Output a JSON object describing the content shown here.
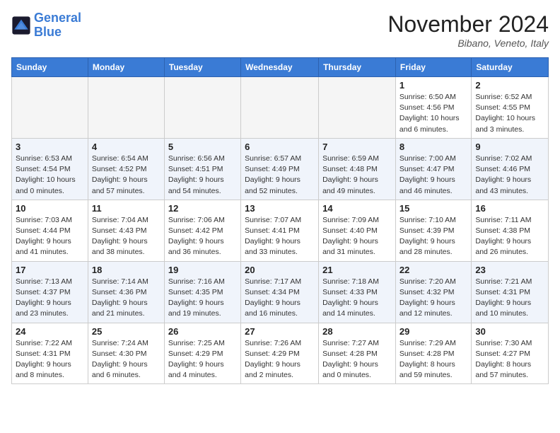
{
  "header": {
    "logo_line1": "General",
    "logo_line2": "Blue",
    "month_title": "November 2024",
    "location": "Bibano, Veneto, Italy"
  },
  "days_of_week": [
    "Sunday",
    "Monday",
    "Tuesday",
    "Wednesday",
    "Thursday",
    "Friday",
    "Saturday"
  ],
  "weeks": [
    [
      {
        "day": "",
        "info": ""
      },
      {
        "day": "",
        "info": ""
      },
      {
        "day": "",
        "info": ""
      },
      {
        "day": "",
        "info": ""
      },
      {
        "day": "",
        "info": ""
      },
      {
        "day": "1",
        "info": "Sunrise: 6:50 AM\nSunset: 4:56 PM\nDaylight: 10 hours\nand 6 minutes."
      },
      {
        "day": "2",
        "info": "Sunrise: 6:52 AM\nSunset: 4:55 PM\nDaylight: 10 hours\nand 3 minutes."
      }
    ],
    [
      {
        "day": "3",
        "info": "Sunrise: 6:53 AM\nSunset: 4:54 PM\nDaylight: 10 hours\nand 0 minutes."
      },
      {
        "day": "4",
        "info": "Sunrise: 6:54 AM\nSunset: 4:52 PM\nDaylight: 9 hours\nand 57 minutes."
      },
      {
        "day": "5",
        "info": "Sunrise: 6:56 AM\nSunset: 4:51 PM\nDaylight: 9 hours\nand 54 minutes."
      },
      {
        "day": "6",
        "info": "Sunrise: 6:57 AM\nSunset: 4:49 PM\nDaylight: 9 hours\nand 52 minutes."
      },
      {
        "day": "7",
        "info": "Sunrise: 6:59 AM\nSunset: 4:48 PM\nDaylight: 9 hours\nand 49 minutes."
      },
      {
        "day": "8",
        "info": "Sunrise: 7:00 AM\nSunset: 4:47 PM\nDaylight: 9 hours\nand 46 minutes."
      },
      {
        "day": "9",
        "info": "Sunrise: 7:02 AM\nSunset: 4:46 PM\nDaylight: 9 hours\nand 43 minutes."
      }
    ],
    [
      {
        "day": "10",
        "info": "Sunrise: 7:03 AM\nSunset: 4:44 PM\nDaylight: 9 hours\nand 41 minutes."
      },
      {
        "day": "11",
        "info": "Sunrise: 7:04 AM\nSunset: 4:43 PM\nDaylight: 9 hours\nand 38 minutes."
      },
      {
        "day": "12",
        "info": "Sunrise: 7:06 AM\nSunset: 4:42 PM\nDaylight: 9 hours\nand 36 minutes."
      },
      {
        "day": "13",
        "info": "Sunrise: 7:07 AM\nSunset: 4:41 PM\nDaylight: 9 hours\nand 33 minutes."
      },
      {
        "day": "14",
        "info": "Sunrise: 7:09 AM\nSunset: 4:40 PM\nDaylight: 9 hours\nand 31 minutes."
      },
      {
        "day": "15",
        "info": "Sunrise: 7:10 AM\nSunset: 4:39 PM\nDaylight: 9 hours\nand 28 minutes."
      },
      {
        "day": "16",
        "info": "Sunrise: 7:11 AM\nSunset: 4:38 PM\nDaylight: 9 hours\nand 26 minutes."
      }
    ],
    [
      {
        "day": "17",
        "info": "Sunrise: 7:13 AM\nSunset: 4:37 PM\nDaylight: 9 hours\nand 23 minutes."
      },
      {
        "day": "18",
        "info": "Sunrise: 7:14 AM\nSunset: 4:36 PM\nDaylight: 9 hours\nand 21 minutes."
      },
      {
        "day": "19",
        "info": "Sunrise: 7:16 AM\nSunset: 4:35 PM\nDaylight: 9 hours\nand 19 minutes."
      },
      {
        "day": "20",
        "info": "Sunrise: 7:17 AM\nSunset: 4:34 PM\nDaylight: 9 hours\nand 16 minutes."
      },
      {
        "day": "21",
        "info": "Sunrise: 7:18 AM\nSunset: 4:33 PM\nDaylight: 9 hours\nand 14 minutes."
      },
      {
        "day": "22",
        "info": "Sunrise: 7:20 AM\nSunset: 4:32 PM\nDaylight: 9 hours\nand 12 minutes."
      },
      {
        "day": "23",
        "info": "Sunrise: 7:21 AM\nSunset: 4:31 PM\nDaylight: 9 hours\nand 10 minutes."
      }
    ],
    [
      {
        "day": "24",
        "info": "Sunrise: 7:22 AM\nSunset: 4:31 PM\nDaylight: 9 hours\nand 8 minutes."
      },
      {
        "day": "25",
        "info": "Sunrise: 7:24 AM\nSunset: 4:30 PM\nDaylight: 9 hours\nand 6 minutes."
      },
      {
        "day": "26",
        "info": "Sunrise: 7:25 AM\nSunset: 4:29 PM\nDaylight: 9 hours\nand 4 minutes."
      },
      {
        "day": "27",
        "info": "Sunrise: 7:26 AM\nSunset: 4:29 PM\nDaylight: 9 hours\nand 2 minutes."
      },
      {
        "day": "28",
        "info": "Sunrise: 7:27 AM\nSunset: 4:28 PM\nDaylight: 9 hours\nand 0 minutes."
      },
      {
        "day": "29",
        "info": "Sunrise: 7:29 AM\nSunset: 4:28 PM\nDaylight: 8 hours\nand 59 minutes."
      },
      {
        "day": "30",
        "info": "Sunrise: 7:30 AM\nSunset: 4:27 PM\nDaylight: 8 hours\nand 57 minutes."
      }
    ]
  ]
}
